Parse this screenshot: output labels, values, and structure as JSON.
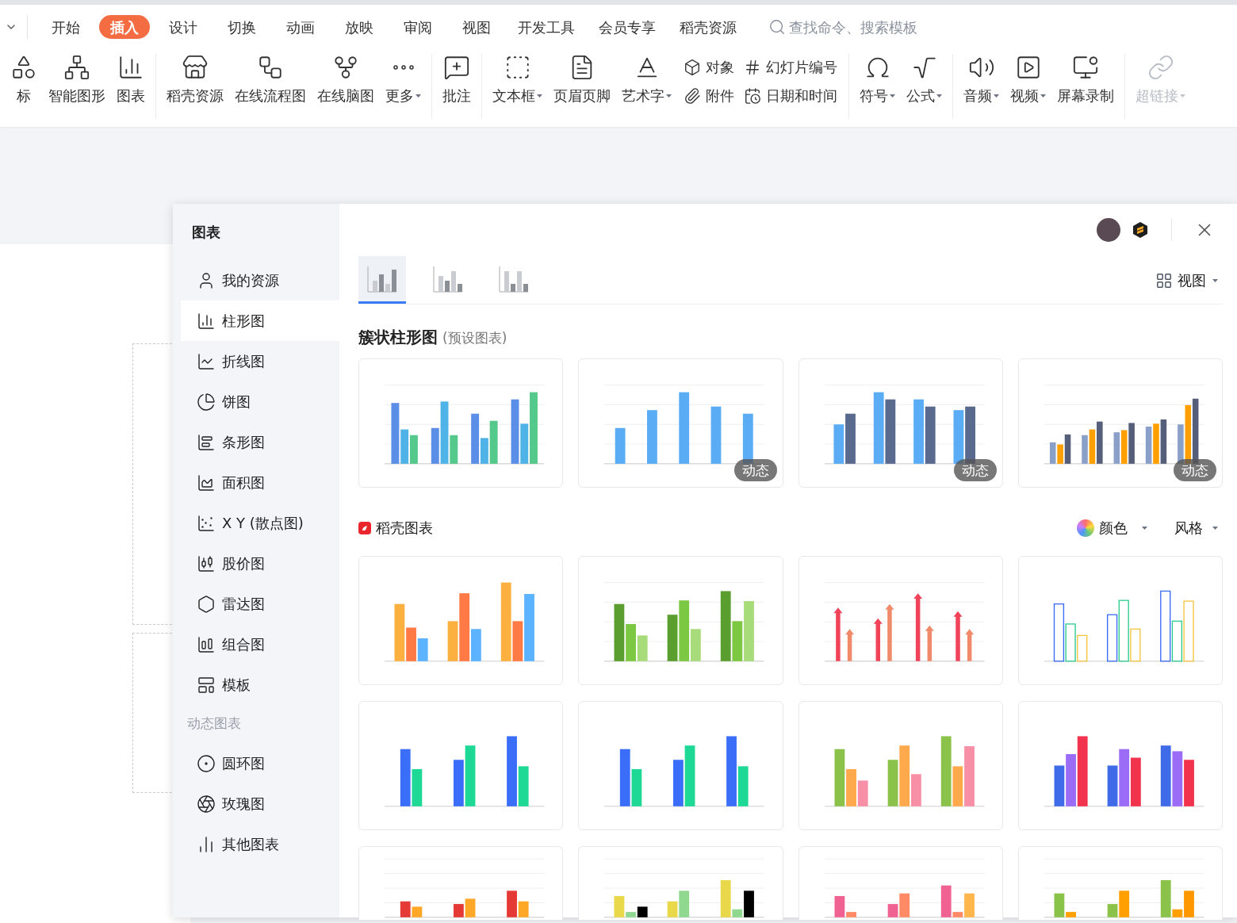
{
  "ribbon": {
    "tabs": [
      {
        "label": "开始",
        "selected": false
      },
      {
        "label": "插入",
        "selected": true
      },
      {
        "label": "设计",
        "selected": false
      },
      {
        "label": "切换",
        "selected": false
      },
      {
        "label": "动画",
        "selected": false
      },
      {
        "label": "放映",
        "selected": false
      },
      {
        "label": "审阅",
        "selected": false
      },
      {
        "label": "视图",
        "selected": false
      },
      {
        "label": "开发工具",
        "selected": false
      },
      {
        "label": "会员专享",
        "selected": false
      },
      {
        "label": "稻壳资源",
        "selected": false
      }
    ],
    "search": {
      "placeholder": "查找命令、搜索模板"
    },
    "groups": [
      {
        "items": [
          {
            "kind": "large",
            "label": "标",
            "dropdown": false,
            "disabled": false
          },
          {
            "kind": "large",
            "label": "智能图形",
            "dropdown": false,
            "disabled": false
          },
          {
            "kind": "large",
            "label": "图表",
            "dropdown": false,
            "disabled": false
          }
        ]
      },
      {
        "items": [
          {
            "kind": "large",
            "label": "稻壳资源",
            "dropdown": false,
            "disabled": false
          },
          {
            "kind": "large",
            "label": "在线流程图",
            "dropdown": false,
            "disabled": false
          },
          {
            "kind": "large",
            "label": "在线脑图",
            "dropdown": false,
            "disabled": false
          },
          {
            "kind": "large",
            "label": "更多",
            "dropdown": true,
            "disabled": false
          }
        ]
      },
      {
        "items": [
          {
            "kind": "large",
            "label": "批注",
            "dropdown": false,
            "disabled": false
          }
        ]
      },
      {
        "items": [
          {
            "kind": "large",
            "label": "文本框",
            "dropdown": true,
            "disabled": false
          },
          {
            "kind": "large",
            "label": "页眉页脚",
            "dropdown": false,
            "disabled": false
          },
          {
            "kind": "large",
            "label": "艺术字",
            "dropdown": true,
            "disabled": false
          },
          {
            "kind": "small",
            "label": "对象",
            "dropdown": false,
            "disabled": false
          },
          {
            "kind": "small",
            "label": "附件",
            "dropdown": false,
            "disabled": false
          },
          {
            "kind": "small",
            "label": "幻灯片编号",
            "dropdown": false,
            "disabled": false
          },
          {
            "kind": "small",
            "label": "日期和时间",
            "dropdown": false,
            "disabled": false
          }
        ]
      },
      {
        "items": [
          {
            "kind": "large",
            "label": "符号",
            "dropdown": true,
            "disabled": false
          },
          {
            "kind": "large",
            "label": "公式",
            "dropdown": true,
            "disabled": false
          }
        ]
      },
      {
        "items": [
          {
            "kind": "large",
            "label": "音频",
            "dropdown": true,
            "disabled": false
          },
          {
            "kind": "large",
            "label": "视频",
            "dropdown": true,
            "disabled": false
          },
          {
            "kind": "large",
            "label": "屏幕录制",
            "dropdown": false,
            "disabled": false
          }
        ]
      },
      {
        "items": [
          {
            "kind": "large",
            "label": "超链接",
            "dropdown": true,
            "disabled": true
          }
        ]
      }
    ]
  },
  "dialog": {
    "title": "图表",
    "sidebar": [
      {
        "kind": "item",
        "label": "我的资源",
        "selected": false
      },
      {
        "kind": "item",
        "label": "柱形图",
        "selected": true
      },
      {
        "kind": "item",
        "label": "折线图",
        "selected": false
      },
      {
        "kind": "item",
        "label": "饼图",
        "selected": false
      },
      {
        "kind": "item",
        "label": "条形图",
        "selected": false
      },
      {
        "kind": "item",
        "label": "面积图",
        "selected": false
      },
      {
        "kind": "item",
        "label": "X Y (散点图)",
        "selected": false
      },
      {
        "kind": "item",
        "label": "股价图",
        "selected": false
      },
      {
        "kind": "item",
        "label": "雷达图",
        "selected": false
      },
      {
        "kind": "item",
        "label": "组合图",
        "selected": false
      },
      {
        "kind": "item",
        "label": "模板",
        "selected": false
      },
      {
        "kind": "section",
        "label": "动态图表"
      },
      {
        "kind": "item",
        "label": "圆环图",
        "selected": false
      },
      {
        "kind": "item",
        "label": "玫瑰图",
        "selected": false
      },
      {
        "kind": "item",
        "label": "其他图表",
        "selected": false
      }
    ],
    "type_tabs": [
      {
        "selected": true
      },
      {
        "selected": false
      },
      {
        "selected": false
      }
    ],
    "view_button": "视图",
    "preset": {
      "title": "簇状柱形图",
      "subtitle": "(预设图表)",
      "cards": [
        {
          "kind": "chart_preview"
        },
        {
          "kind": "chart_preview",
          "badge": "动态"
        },
        {
          "kind": "chart_preview",
          "badge": "动态"
        },
        {
          "kind": "chart_preview",
          "badge": "动态"
        }
      ]
    },
    "docer": {
      "title": "稻壳图表",
      "color_filter": "颜色",
      "style_filter": "风格",
      "cards": [
        {
          "kind": "chart_preview"
        },
        {
          "kind": "chart_preview"
        },
        {
          "kind": "chart_preview"
        },
        {
          "kind": "chart_preview"
        },
        {
          "kind": "chart_preview"
        },
        {
          "kind": "chart_preview"
        },
        {
          "kind": "chart_preview"
        },
        {
          "kind": "chart_preview"
        },
        {
          "kind": "chart_preview"
        },
        {
          "kind": "chart_preview"
        },
        {
          "kind": "chart_preview"
        },
        {
          "kind": "chart_preview"
        }
      ]
    }
  }
}
